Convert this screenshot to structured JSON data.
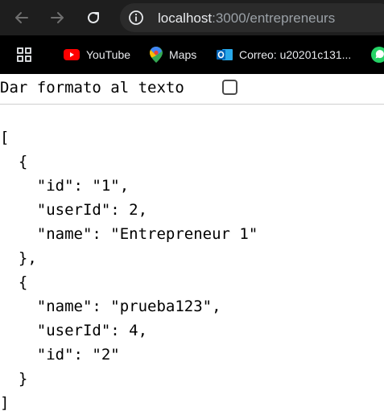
{
  "browser": {
    "url_host": "localhost",
    "url_path": ":3000/entrepreneurs"
  },
  "bookmarks": [
    {
      "label": "YouTube",
      "icon": "youtube-icon"
    },
    {
      "label": "Maps",
      "icon": "maps-icon"
    },
    {
      "label": "Correo: u20201c131...",
      "icon": "outlook-icon"
    }
  ],
  "format_bar": {
    "label": "Dar formato al texto",
    "checked": false
  },
  "json_lines": [
    "[",
    "  {",
    "    \"id\": \"1\",",
    "    \"userId\": 2,",
    "    \"name\": \"Entrepreneur 1\"",
    "  },",
    "  {",
    "    \"name\": \"prueba123\",",
    "    \"userId\": 4,",
    "    \"id\": \"2\"",
    "  }",
    "]"
  ]
}
